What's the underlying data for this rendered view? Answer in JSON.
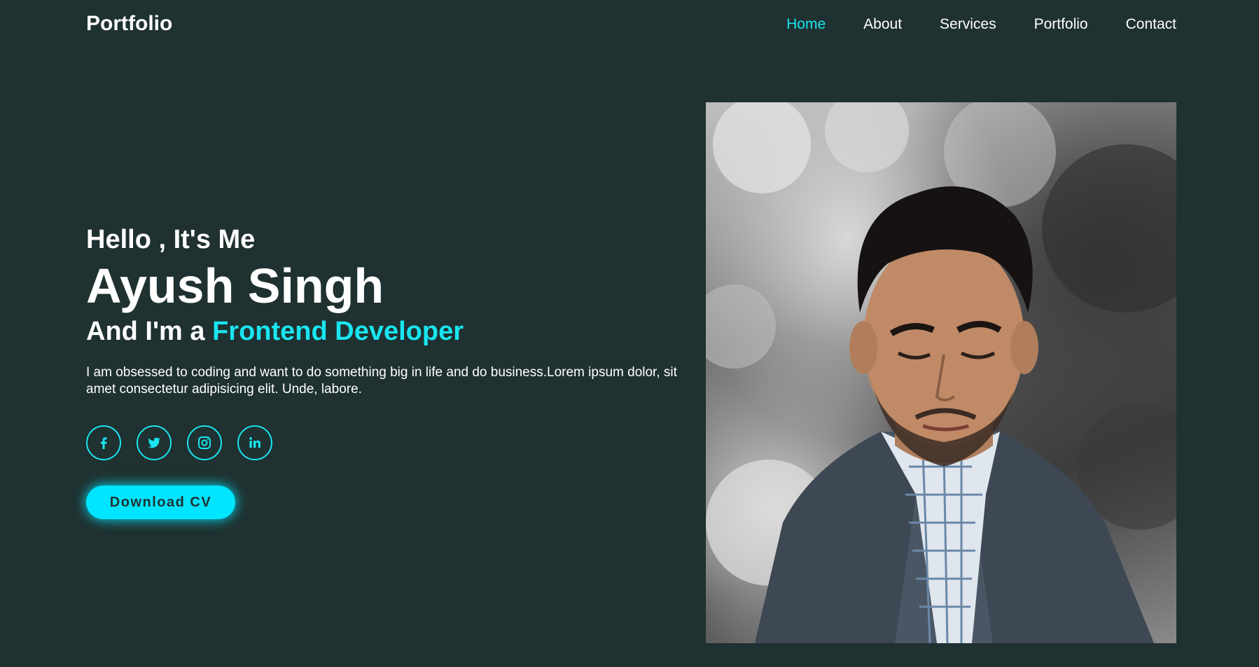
{
  "header": {
    "logo": "Portfolio",
    "nav": [
      "Home",
      "About",
      "Services",
      "Portfolio",
      "Contact"
    ],
    "active": "Home"
  },
  "hero": {
    "greeting": "Hello , It's Me",
    "name": "Ayush Singh",
    "role_prefix": "And I'm a ",
    "role_highlight": "Frontend Developer",
    "description": "I am obsessed to coding and want to do something big in life and do business.Lorem ipsum dolor, sit amet consectetur adipisicing elit. Unde, labore.",
    "socials": [
      "facebook-icon",
      "twitter-icon",
      "instagram-icon",
      "linkedin-icon"
    ],
    "button": "Download CV"
  },
  "colors": {
    "background": "#1f3130",
    "accent": "#19e5f0",
    "button": "#00e5ff",
    "text": "#ffffff"
  }
}
